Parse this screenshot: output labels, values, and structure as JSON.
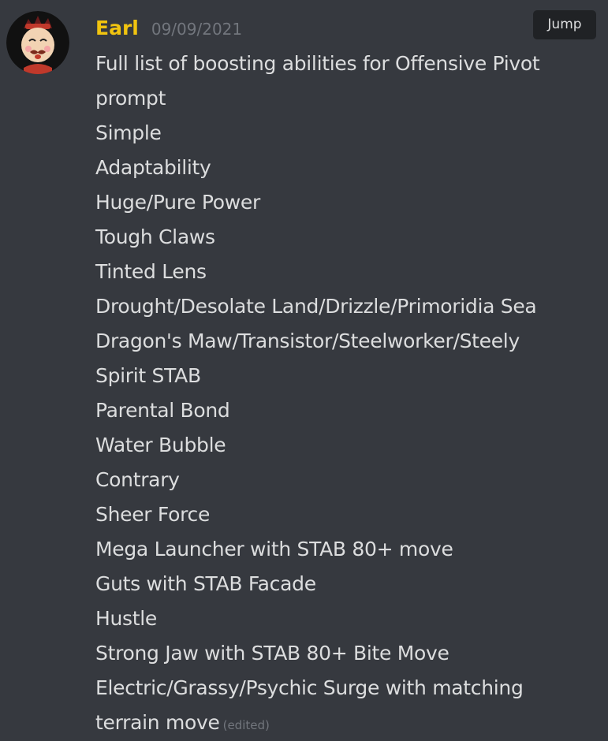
{
  "message": {
    "author": "Earl",
    "timestamp": "09/09/2021",
    "author_color": "#f1c40f",
    "jump_label": "Jump",
    "lines": [
      "Full list of boosting abilities for Offensive Pivot",
      "prompt",
      "Simple",
      "Adaptability",
      "Huge/Pure Power",
      "Tough Claws",
      "Tinted Lens",
      "Drought/Desolate Land/Drizzle/Primoridia Sea",
      "Dragon's Maw/Transistor/Steelworker/Steely",
      "Spirit STAB",
      "Parental Bond",
      "Water Bubble",
      "Contrary",
      "Sheer Force",
      "Mega Launcher with STAB 80+ move",
      "Guts with STAB Facade",
      "Hustle",
      "Strong Jaw with STAB 80+ Bite Move",
      "Electric/Grassy/Psychic Surge with matching",
      "terrain move"
    ],
    "edited_label": "(edited)"
  },
  "colors": {
    "background": "#36393f",
    "text": "#dcddde",
    "muted": "#72767d",
    "jump_bg": "#202225"
  }
}
